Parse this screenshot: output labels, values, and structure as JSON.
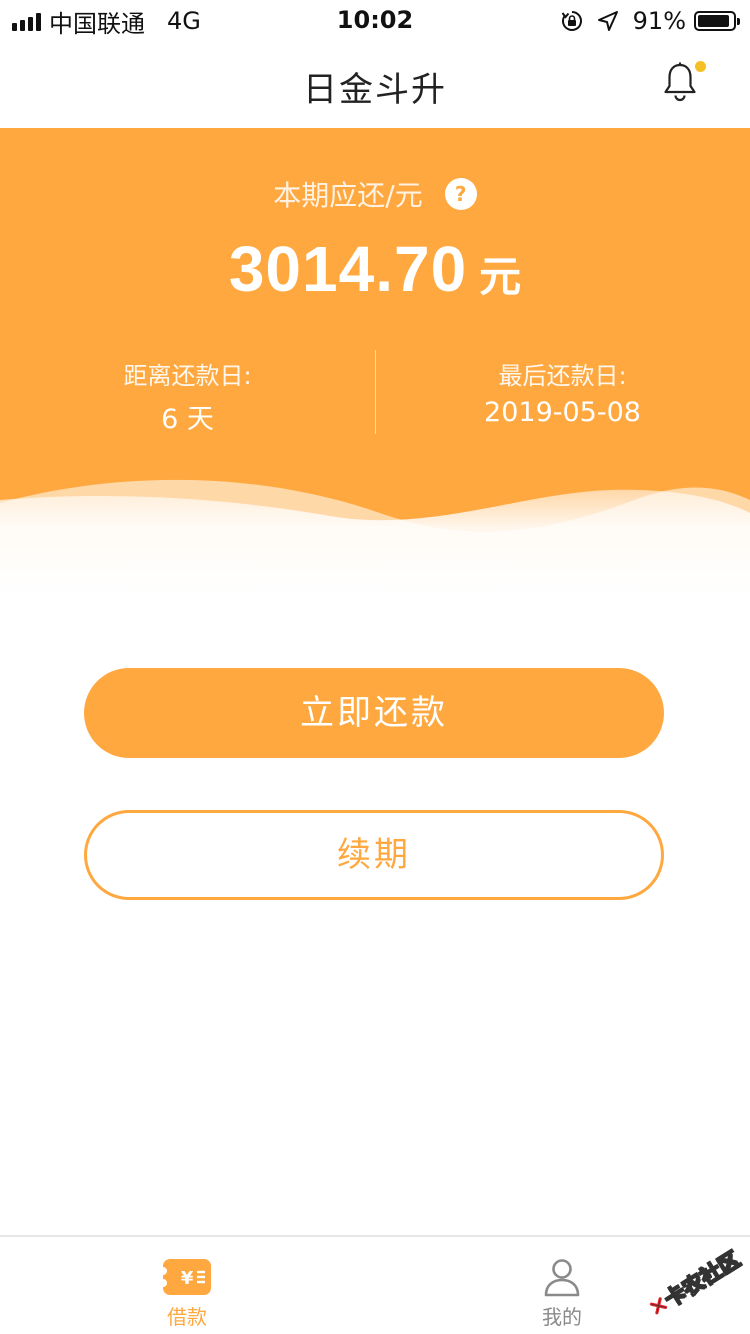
{
  "status_bar": {
    "carrier": "中国联通",
    "network": "4G",
    "time": "10:02",
    "battery_percent": "91%",
    "battery_level": 0.91
  },
  "nav": {
    "title": "日金斗升",
    "has_notification_dot": true
  },
  "hero": {
    "due_label": "本期应还/元",
    "help_symbol": "?",
    "amount": "3014.70",
    "amount_unit": "元",
    "days_left_label": "距离还款日:",
    "days_left_value": "6 天",
    "last_date_label": "最后还款日:",
    "last_date_value": "2019-05-08"
  },
  "actions": {
    "repay_label": "立即还款",
    "renew_label": "续期"
  },
  "tab_bar": {
    "items": [
      {
        "label": "借款",
        "icon": "loan-icon",
        "active": true
      },
      {
        "label": "我的",
        "icon": "user-icon",
        "active": false
      }
    ]
  },
  "watermark": {
    "text": "卡农社区"
  },
  "colors": {
    "accent": "#ffa83f",
    "notification_dot": "#f5c024",
    "tab_inactive": "#8a8a8a"
  }
}
